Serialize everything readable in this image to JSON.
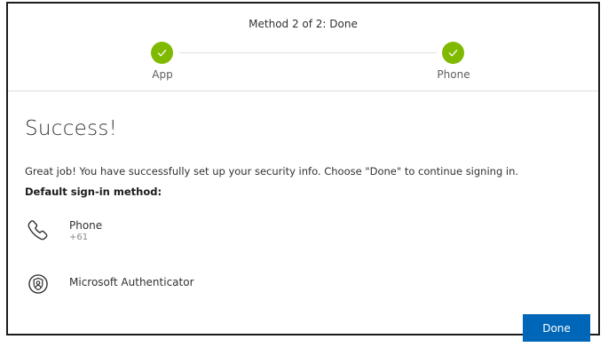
{
  "header": {
    "step_title": "Method 2 of 2: Done",
    "steps": [
      {
        "label": "App",
        "status": "complete"
      },
      {
        "label": "Phone",
        "status": "complete"
      }
    ]
  },
  "main": {
    "title": "Success!",
    "message": "Great job! You have successfully set up your security info. Choose \"Done\" to continue signing in.",
    "default_label": "Default sign-in method:",
    "methods": [
      {
        "name": "Phone",
        "detail": "+61",
        "icon": "phone-icon"
      },
      {
        "name": "Microsoft Authenticator",
        "icon": "authenticator-icon"
      }
    ]
  },
  "actions": {
    "done_label": "Done"
  },
  "colors": {
    "check_green": "#7fba00",
    "primary_blue": "#0067b8"
  }
}
